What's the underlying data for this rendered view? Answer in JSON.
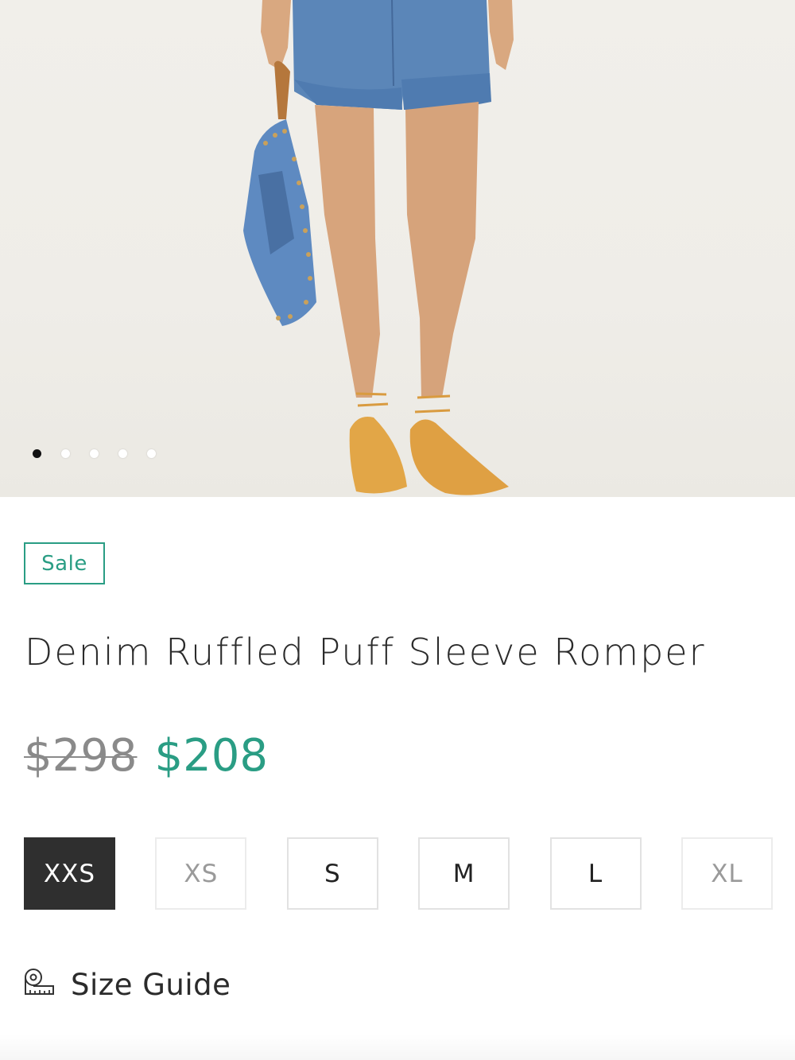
{
  "product": {
    "badge": "Sale",
    "title": "Denim Ruffled Puff Sleeve Romper",
    "original_price": "$298",
    "sale_price": "$208",
    "carousel": {
      "total_slides": 5,
      "active_slide": 1
    },
    "sizes": [
      {
        "label": "XXS",
        "state": "selected"
      },
      {
        "label": "XS",
        "state": "unavailable"
      },
      {
        "label": "S",
        "state": "available"
      },
      {
        "label": "M",
        "state": "available"
      },
      {
        "label": "L",
        "state": "available"
      },
      {
        "label": "XL",
        "state": "unavailable"
      }
    ],
    "size_guide": {
      "label": "Size Guide",
      "icon": "measuring-tape-icon"
    }
  },
  "colors": {
    "accent": "#2a9d84",
    "selected_size_bg": "#2f2f2f",
    "strikethrough_price": "#8a8a8a"
  }
}
